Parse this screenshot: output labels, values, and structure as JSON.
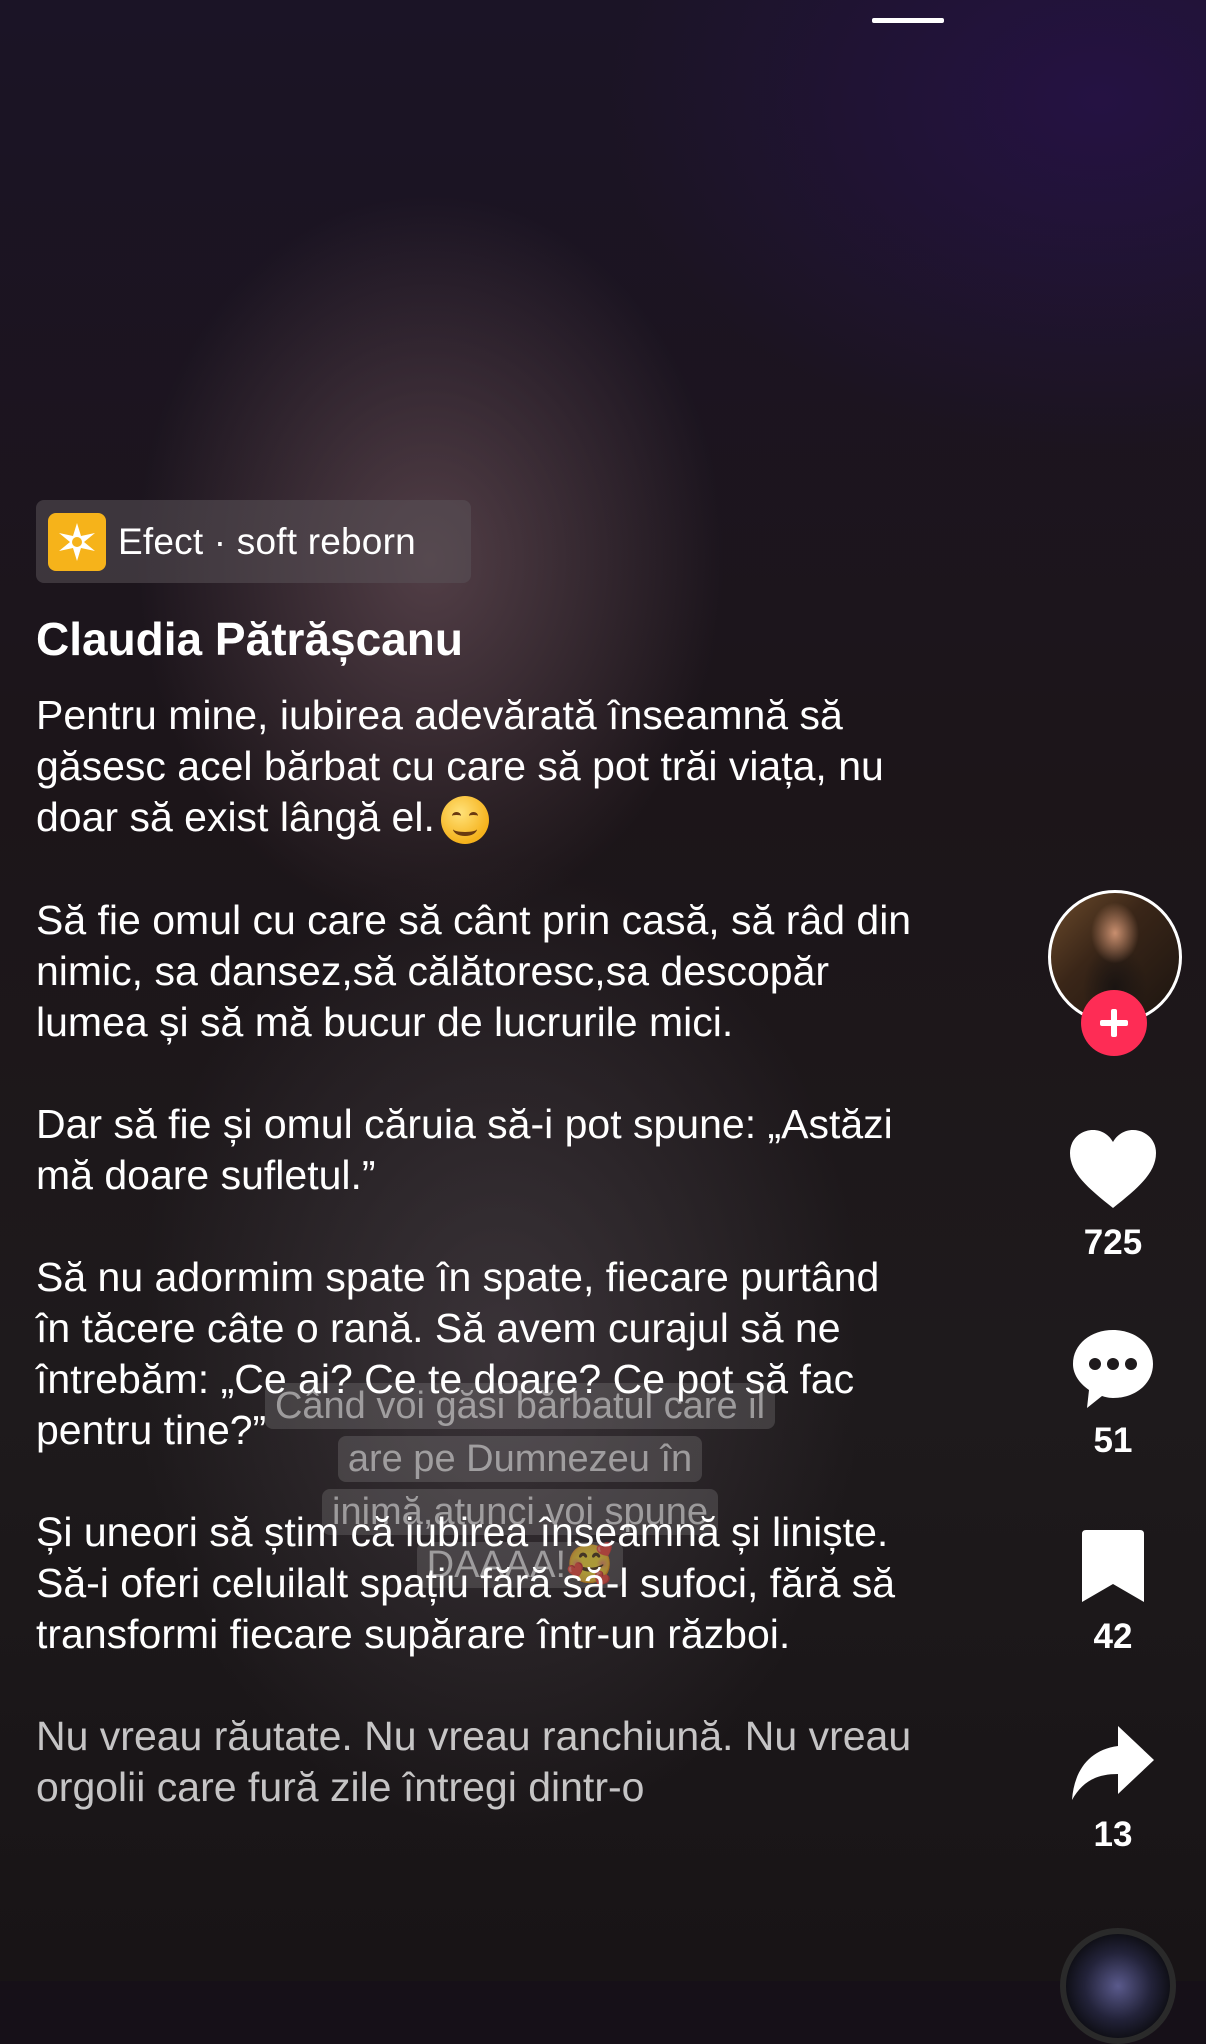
{
  "effect": {
    "label": "Efect · soft reborn"
  },
  "post": {
    "username": "Claudia Pătrășcanu",
    "caption": [
      "Pentru mine, iubirea adevărată înseamnă să găsesc acel bărbat cu care să pot trăi viața, nu doar să exist lângă el.",
      "Să fie omul cu care să cânt prin casă, să râd din nimic, sa dansez,să călătoresc,sa descopăr lumea și să mă bucur de lucrurile mici.",
      "Dar să fie și omul căruia să-i pot spune: „Astăzi mă doare sufletul.”",
      "Să nu adormim spate în spate, fiecare purtând în tăcere câte o rană. Să avem curajul să ne întrebăm: „Ce ai? Ce te doare? Ce pot să fac pentru tine?”",
      "Și uneori să știm că iubirea înseamnă și liniște. Să-i oferi celuilalt spațiu fără să-l sufoci, fără să transformi fiecare supărare într-un război.",
      "Nu vreau răutate. Nu vreau ranchiună. Nu vreau orgolii care fură zile întregi dintr-o"
    ],
    "overlay_text": [
      "Când voi găsi bărbatul care il",
      "are pe Dumnezeu în",
      "inimă,atunci voi spune",
      "DAAAA!🥰"
    ]
  },
  "actions": {
    "likes": "725",
    "comments": "51",
    "saves": "42",
    "shares": "13"
  },
  "colors": {
    "accent": "#fe2c55",
    "effect_icon": "#f6b31a"
  }
}
